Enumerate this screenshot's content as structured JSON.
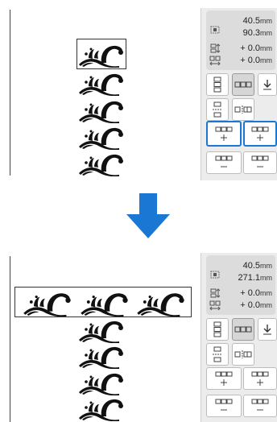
{
  "top": {
    "width": {
      "value": "40.5",
      "unit": "mm"
    },
    "height": {
      "value": "90.3",
      "unit": "mm"
    },
    "offset_y": {
      "value": "+ 0.0",
      "unit": "mm"
    },
    "offset_x": {
      "value": "+ 0.0",
      "unit": "mm"
    }
  },
  "bottom": {
    "width": {
      "value": "40.5",
      "unit": "mm"
    },
    "height": {
      "value": "271.1",
      "unit": "mm"
    },
    "offset_y": {
      "value": "+ 0.0",
      "unit": "mm"
    },
    "offset_x": {
      "value": "+ 0.0",
      "unit": "mm"
    }
  },
  "arrow": {
    "color": "#1a78d4",
    "icon": "arrow-down-icon"
  },
  "colors": {
    "highlight": "#1a78d4",
    "pattern": "#111111",
    "panel": "#ececec"
  }
}
